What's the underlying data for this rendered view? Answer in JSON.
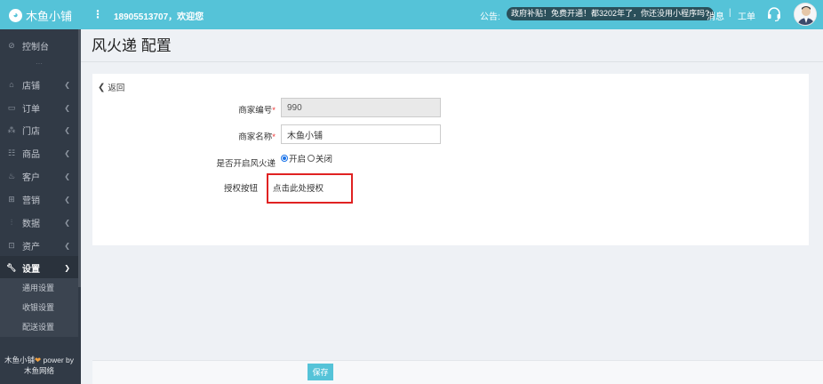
{
  "brand": {
    "logo_text": "木鱼小铺",
    "logo_icon": "fish-logo-icon"
  },
  "header": {
    "menu_icon": "vertical-dots-icon",
    "welcome": "18905513707，欢迎您",
    "notice_label": "公告:",
    "notice_text": "政府补贴！免费开通！都3202年了，你还没用小程序吗?",
    "messages_label": "消息",
    "separator": "|",
    "ticket_label": "工单",
    "support_icon": "headset-icon",
    "avatar_icon": "user-avatar-icon",
    "bar_color": "#55c3d8"
  },
  "sidebar": {
    "dashboard": {
      "label": "控制台",
      "icon": "dashboard-icon"
    },
    "items": [
      {
        "label": "店铺",
        "icon": "store-icon"
      },
      {
        "label": "订单",
        "icon": "order-icon"
      },
      {
        "label": "门店",
        "icon": "branch-icon"
      },
      {
        "label": "商品",
        "icon": "goods-icon"
      },
      {
        "label": "客户",
        "icon": "customer-icon"
      },
      {
        "label": "营销",
        "icon": "marketing-icon"
      },
      {
        "label": "数据",
        "icon": "data-icon"
      },
      {
        "label": "资产",
        "icon": "assets-icon"
      },
      {
        "label": "设置",
        "icon": "wrench-icon",
        "active": true
      }
    ],
    "subitems": [
      "通用设置",
      "收银设置",
      "配送设置"
    ],
    "footer_line1": "木鱼小铺",
    "footer_power": " power by",
    "footer_line2": "木鱼网络"
  },
  "page": {
    "title": "风火递 配置"
  },
  "form": {
    "back_label": "返回",
    "merchant_id_label": "商家编号",
    "merchant_id_value": "990",
    "merchant_name_label": "商家名称",
    "merchant_name_value": "木鱼小铺",
    "enable_label": "是否开启风火递",
    "enable_options": [
      "开启",
      "关闭"
    ],
    "enable_selected": "开启",
    "auth_label": "授权按钮",
    "auth_link": "点击此处授权",
    "required_mark": "*"
  },
  "footer": {
    "save_label": "保存"
  }
}
